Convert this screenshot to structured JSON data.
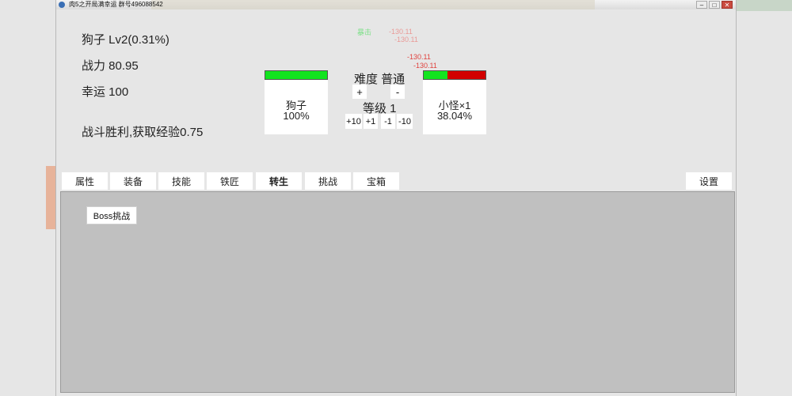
{
  "window": {
    "title": "肉5之开局满幸运 群号496088542",
    "controls": {
      "minimize": "–",
      "maximize": "□",
      "close": "✕"
    }
  },
  "player": {
    "name_level": "狗子 Lv2(0.31%)",
    "power": "战力 80.95",
    "luck": "幸运 100",
    "battle_message": "战斗胜利,获取经验0.75"
  },
  "player_card": {
    "name": "狗子",
    "percent": "100%",
    "hp_fraction": 1.0
  },
  "enemy_card": {
    "name": "小怪×1",
    "percent": "38.04%",
    "hp_fraction": 0.3804
  },
  "difficulty": {
    "label": "难度 普通",
    "plus": "+",
    "minus": "-",
    "level_label": "等级 1",
    "level_buttons": [
      "+10",
      "+1",
      "-1",
      "-10"
    ]
  },
  "floating_texts": {
    "crit": "暴击",
    "damage": [
      "-130.11",
      "-130.11",
      "-130.11",
      "-130.11"
    ]
  },
  "tabs": [
    "属性",
    "装备",
    "技能",
    "铁匠",
    "转生",
    "挑战",
    "宝箱"
  ],
  "active_tab": "转生",
  "settings_label": "设置",
  "boss_button": "Boss挑战",
  "colors": {
    "hp_green": "#12e41f",
    "hp_red": "#d20000",
    "damage_red": "#e0433f",
    "crit_green": "#7fe08a"
  }
}
